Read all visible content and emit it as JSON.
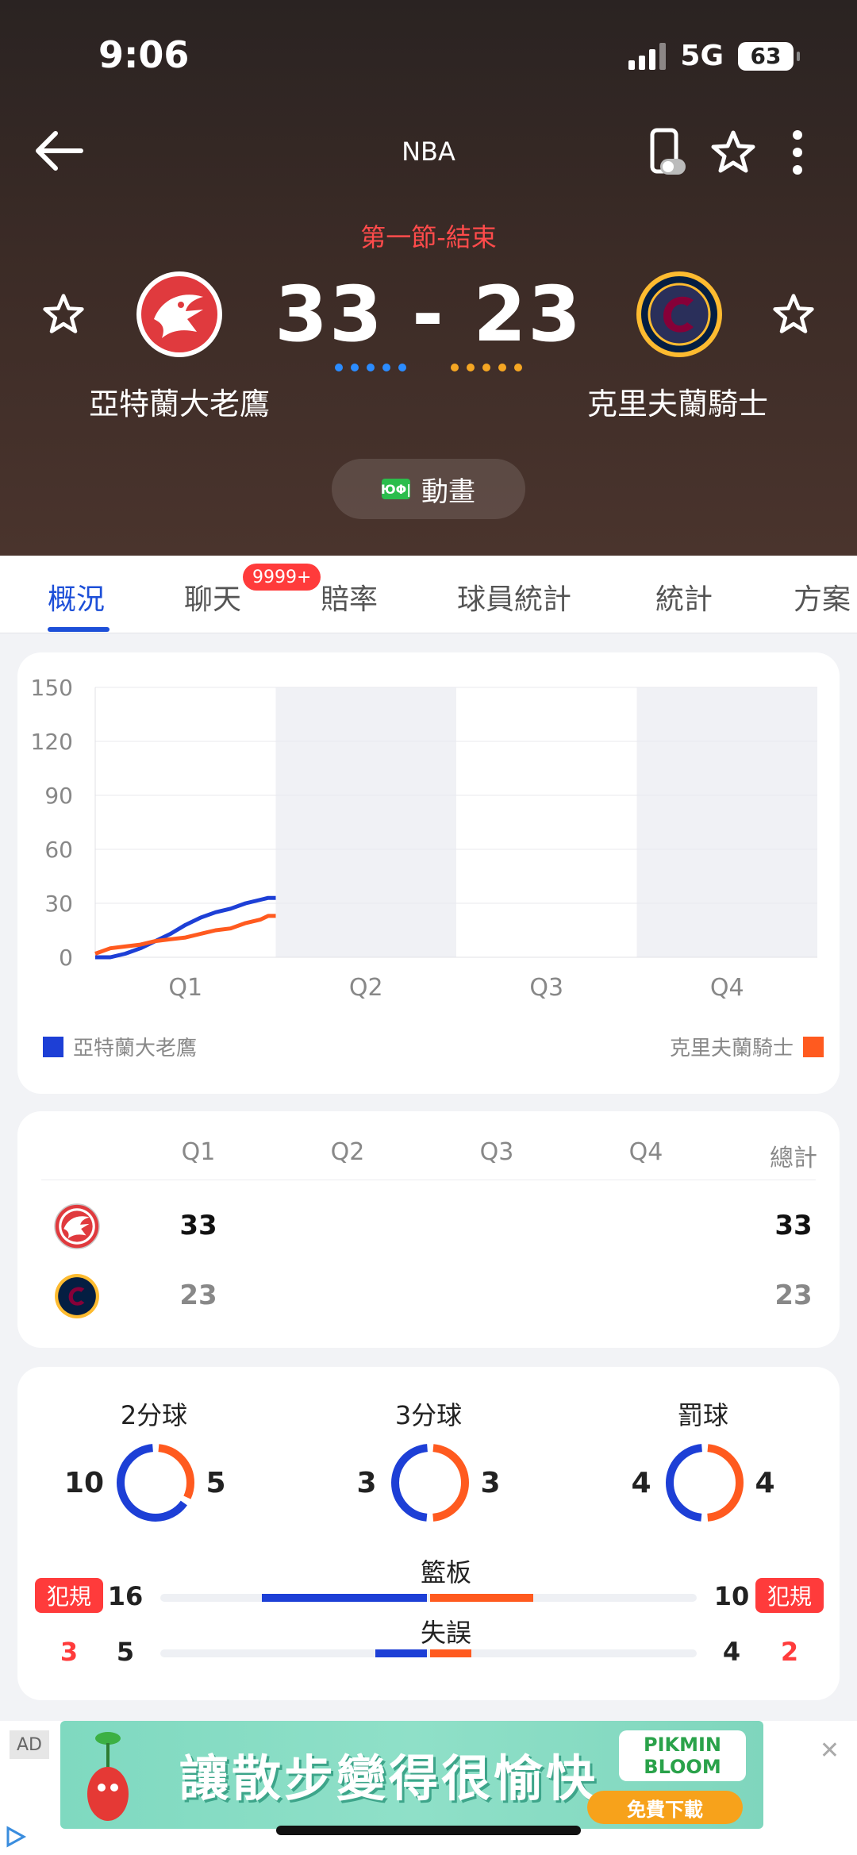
{
  "status_bar": {
    "time": "9:06",
    "network": "5G",
    "battery": "63"
  },
  "nav": {
    "title": "NBA"
  },
  "game": {
    "period": "第一節-結束",
    "score_home": "33",
    "score_away": "23",
    "separator": "-",
    "home_team": "亞特蘭大老鷹",
    "away_team": "克里夫蘭騎士",
    "home_color": "#1d3fd6",
    "away_color": "#ff5a1f",
    "animation_label": "動畫",
    "animation_icon_text": "ЮΦ|"
  },
  "tabs": {
    "items": [
      "概況",
      "聊天",
      "賠率",
      "球員統計",
      "統計",
      "方案"
    ],
    "active": "概況",
    "chat_badge": "9999+"
  },
  "chart_data": {
    "type": "line",
    "title": "",
    "x_categories": [
      "Q1",
      "Q2",
      "Q3",
      "Q4"
    ],
    "y_ticks": [
      "150",
      "120",
      "90",
      "60",
      "30",
      "0"
    ],
    "ylim": [
      0,
      150
    ],
    "grid": true,
    "legend_placement": "bottom",
    "series": [
      {
        "name": "亞特蘭大老鷹",
        "color": "#1d3fd6",
        "points": [
          [
            0,
            0
          ],
          [
            1,
            0
          ],
          [
            2,
            2
          ],
          [
            3,
            5
          ],
          [
            4,
            9
          ],
          [
            5,
            13
          ],
          [
            6,
            18
          ],
          [
            7,
            22
          ],
          [
            8,
            25
          ],
          [
            9,
            27
          ],
          [
            10,
            30
          ],
          [
            11,
            32
          ],
          [
            11.5,
            33
          ],
          [
            12,
            33
          ]
        ]
      },
      {
        "name": "克里夫蘭騎士",
        "color": "#ff5a1f",
        "points": [
          [
            0,
            2
          ],
          [
            1,
            5
          ],
          [
            2,
            6
          ],
          [
            3,
            7
          ],
          [
            4,
            9
          ],
          [
            5,
            10
          ],
          [
            6,
            11
          ],
          [
            7,
            13
          ],
          [
            8,
            15
          ],
          [
            9,
            16
          ],
          [
            10,
            19
          ],
          [
            11,
            21
          ],
          [
            11.5,
            23
          ],
          [
            12,
            23
          ]
        ]
      }
    ]
  },
  "quarter_table": {
    "headers": [
      "Q1",
      "Q2",
      "Q3",
      "Q4",
      "總計"
    ],
    "home": [
      "33",
      "",
      "",
      "",
      "33"
    ],
    "away": [
      "23",
      "",
      "",
      "",
      "23"
    ]
  },
  "shooting": [
    {
      "label": "2分球",
      "home": "10",
      "away": "5"
    },
    {
      "label": "3分球",
      "home": "3",
      "away": "3"
    },
    {
      "label": "罰球",
      "home": "4",
      "away": "4"
    }
  ],
  "bars": [
    {
      "label": "籃板",
      "home": "16",
      "away": "10"
    },
    {
      "label": "失誤",
      "home": "5",
      "away": "4"
    }
  ],
  "fouls": {
    "label": "犯規",
    "home": "3",
    "away": "2"
  },
  "ad": {
    "tag": "AD",
    "headline": "讓散步變得很愉快",
    "brand": "PIKMIN BLOOM",
    "cta": "免費下載",
    "close": "✕"
  }
}
